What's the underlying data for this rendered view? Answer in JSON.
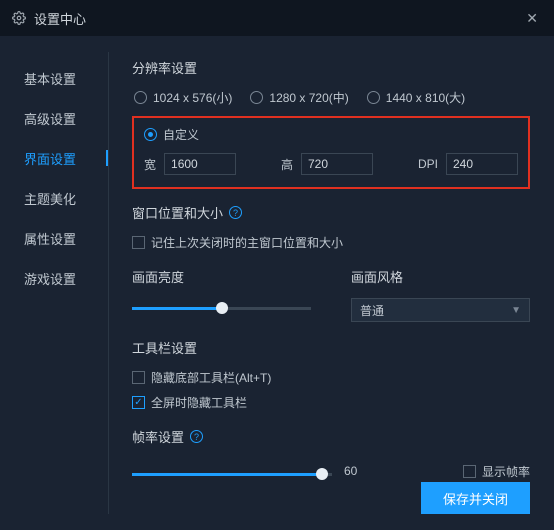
{
  "window": {
    "title": "设置中心"
  },
  "sidebar": {
    "items": [
      {
        "label": "基本设置"
      },
      {
        "label": "高级设置"
      },
      {
        "label": "界面设置"
      },
      {
        "label": "主题美化"
      },
      {
        "label": "属性设置"
      },
      {
        "label": "游戏设置"
      }
    ],
    "active_index": 2
  },
  "resolution": {
    "title": "分辨率设置",
    "options": [
      {
        "label": "1024 x 576(小)"
      },
      {
        "label": "1280 x 720(中)"
      },
      {
        "label": "1440 x 810(大)"
      }
    ],
    "custom_label": "自定义",
    "width_label": "宽",
    "width_value": "1600",
    "height_label": "高",
    "height_value": "720",
    "dpi_label": "DPI",
    "dpi_value": "240"
  },
  "window_pos": {
    "title": "窗口位置和大小",
    "remember_label": "记住上次关闭时的主窗口位置和大小"
  },
  "brightness": {
    "title": "画面亮度",
    "percent": 50
  },
  "style": {
    "title": "画面风格",
    "value": "普通"
  },
  "toolbar": {
    "title": "工具栏设置",
    "hide_bottom_label": "隐藏底部工具栏(Alt+T)",
    "hide_fullscreen_label": "全屏时隐藏工具栏"
  },
  "fps": {
    "title": "帧率设置",
    "value": "60",
    "show_label": "显示帧率",
    "percent": 95
  },
  "footer": {
    "save_label": "保存并关闭"
  }
}
